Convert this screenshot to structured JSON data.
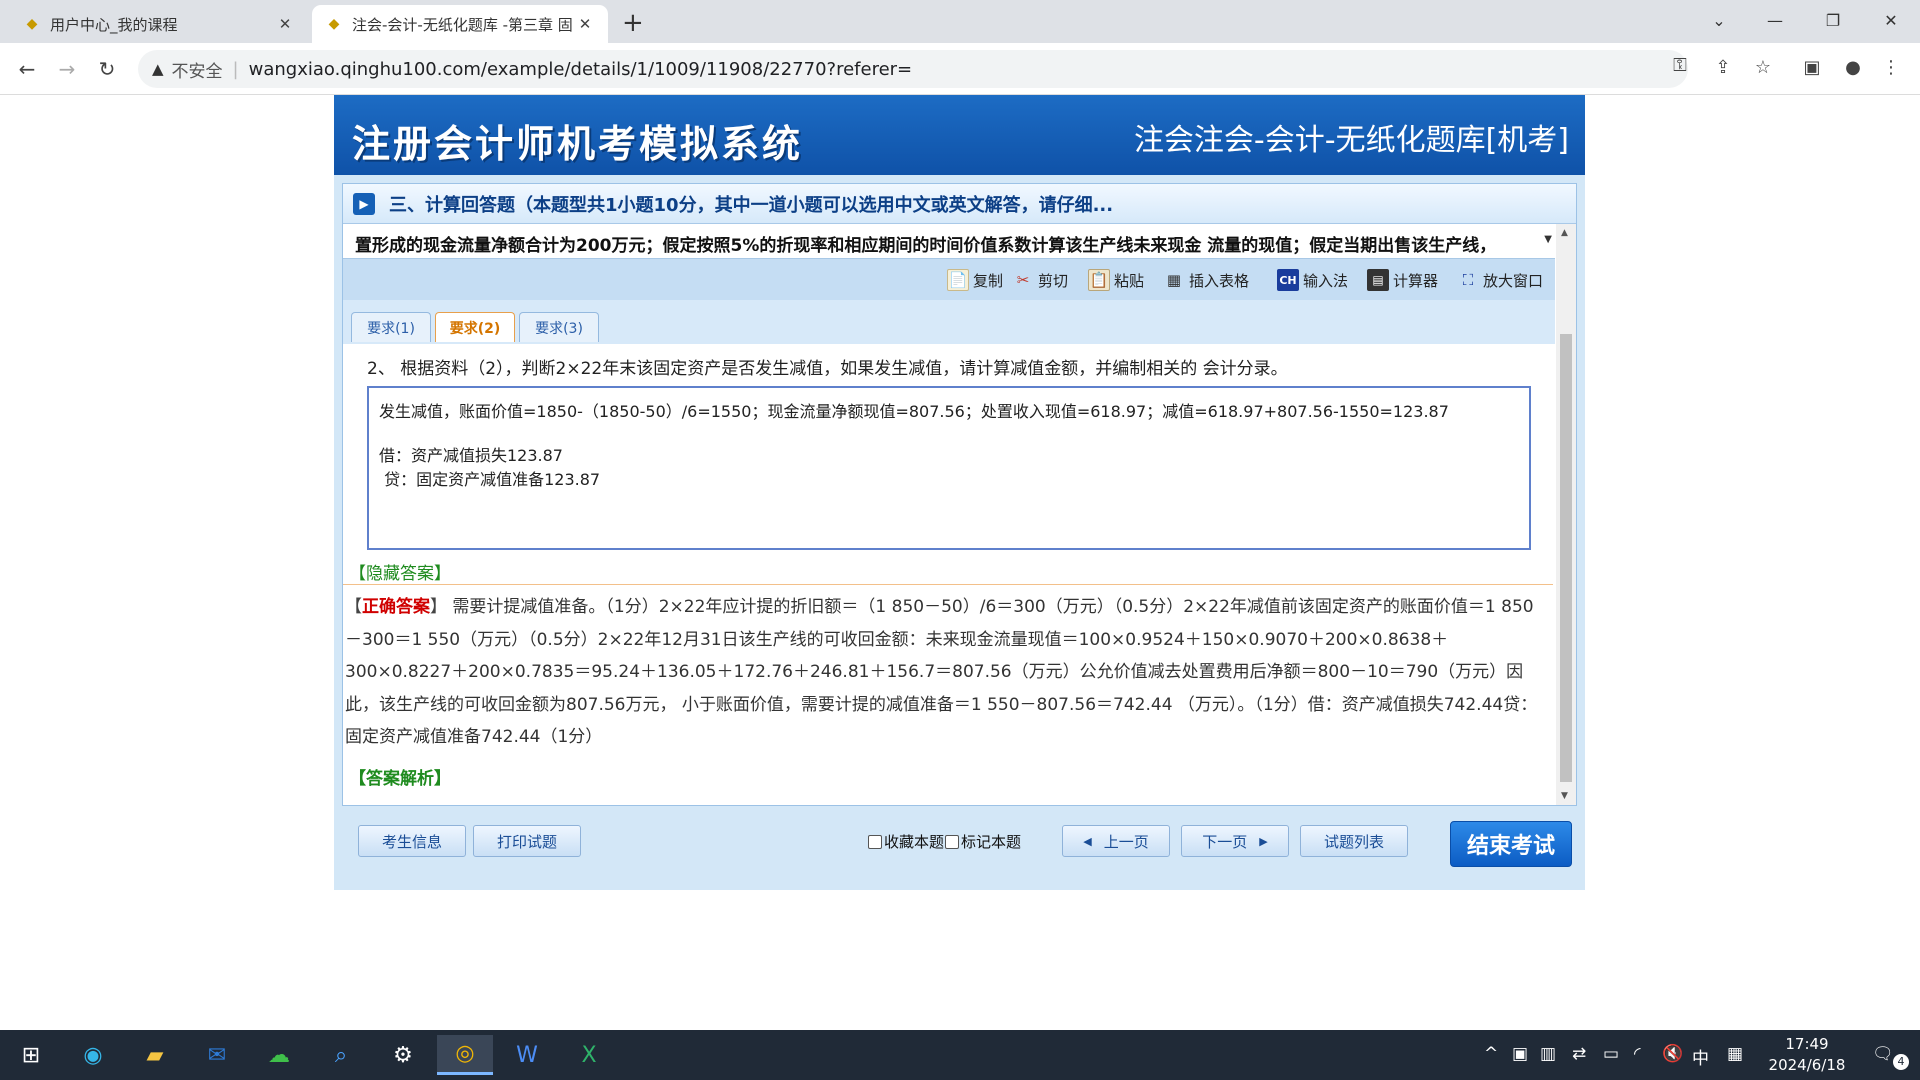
{
  "browser": {
    "tabs": [
      {
        "title": "用户中心_我的课程",
        "close": "✕"
      },
      {
        "title": "注会-会计-无纸化题库 -第三章 固",
        "close": "✕"
      }
    ],
    "new_tab": "+",
    "address": {
      "warning": "不安全",
      "url": "wangxiao.qinghu100.com/example/details/1/1009/11908/22770?referer="
    }
  },
  "page": {
    "banner_left": "注册会计师机考模拟系统",
    "banner_right": "注会注会-会计-无纸化题库[机考]",
    "section_title": "三、计算回答题（本题型共1小题10分，其中一道小题可以选用中文或英文解答，请仔细...",
    "context_line": "置形成的现金流量净额合计为200万元；假定按照5%的折现率和相应期间的时间价值系数计算该生产线未来现金 流量的现值；假定当期出售该生产线，",
    "tools": {
      "copy": "复制",
      "cut": "剪切",
      "paste": "粘贴",
      "insert_table": "插入表格",
      "ime": "输入法",
      "calculator": "计算器",
      "enlarge": "放大窗口"
    },
    "req_tabs": [
      "要求(1)",
      "要求(2)",
      "要求(3)"
    ],
    "active_tab": "要求(2)",
    "requirement": "2、 根据资料（2），判断2×22年末该固定资产是否发生减值，如果发生减值，请计算减值金额，并编制相关的 会计分录。",
    "answer_lines": [
      "发生减值，账面价值=1850-（1850-50）/6=1550；现金流量净额现值=807.56；处置收入现值=618.97；减值=618.97+807.56-1550=123.87",
      "借：资产减值损失123.87",
      " 贷：固定资产减值准备123.87"
    ],
    "hide_answer": "【隐藏答案】",
    "correct_label": "正确答案",
    "correct_text": "需要计提减值准备。（1分）2×22年应计提的折旧额＝（1 850－50）/6＝300（万元）（0.5分）2×22年减值前该固定资产的账面价值＝1 850－300＝1 550（万元）（0.5分）2×22年12月31日该生产线的可收回金额：未来现金流量现值＝100×0.9524＋150×0.9070＋200×0.8638＋300×0.8227＋200×0.7835＝95.24＋136.05＋172.76＋246.81＋156.7＝807.56（万元）公允价值减去处置费用后净额＝800－10＝790（万元）因此，该生产线的可收回金额为807.56万元， 小于账面价值，需要计提的减值准备＝1 550－807.56＝742.44 （万元）。（1分）借：资产减值损失742.44贷：固定资产减值准备742.44（1分）",
    "analysis": "【答案解析】",
    "bottom": {
      "candidate_info": "考生信息",
      "print": "打印试题",
      "favorite": "收藏本题",
      "mark": "标记本题",
      "prev": "上一页",
      "next": "下一页",
      "list": "试题列表",
      "end": "结束考试"
    }
  },
  "taskbar": {
    "ime": "中",
    "time": "17:49",
    "date": "2024/6/18",
    "notif_count": "4"
  }
}
